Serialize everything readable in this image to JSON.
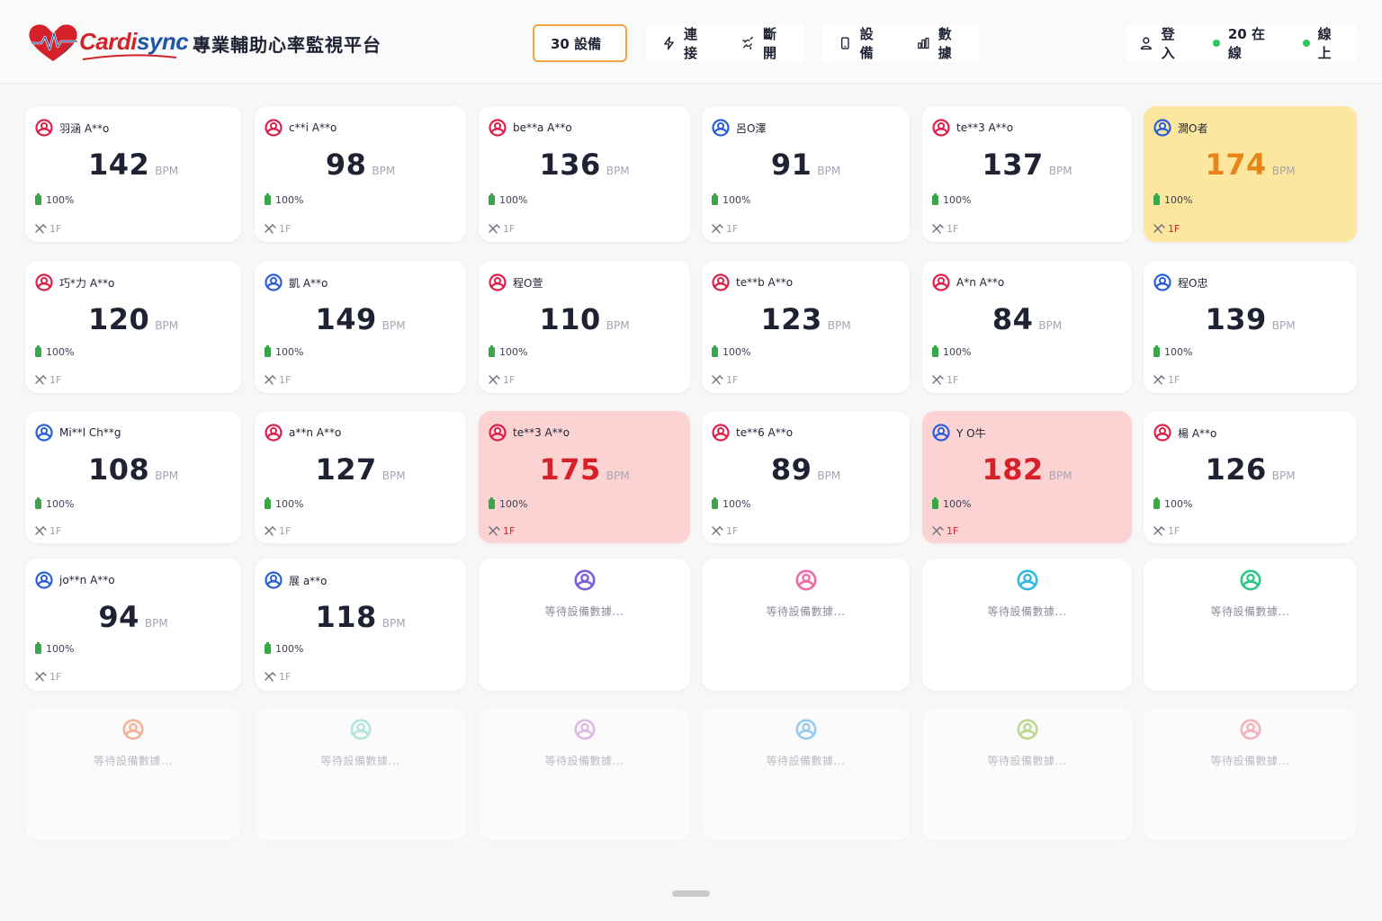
{
  "header": {
    "brand_left": "Cardi",
    "brand_right": "sync",
    "platform_title": "專業輔助心率監視平台",
    "device_count_button": "30 設備",
    "connect_label": "連接",
    "disconnect_label": "斷開",
    "devices_label": "設備",
    "data_label": "數據",
    "login_label": "登入",
    "online_count": "20 在線",
    "online_status": "線上",
    "status_color": "#2fc55a",
    "accent_color": "#f0a44a"
  },
  "unit": "BPM",
  "waiting_text": "等待設備數據...",
  "cards": [
    {
      "name": "羽涵 A**o",
      "bpm": "142",
      "battery": "100%",
      "floor": "1F",
      "gender": "female",
      "state": "normal"
    },
    {
      "name": "c**i A**o",
      "bpm": "98",
      "battery": "100%",
      "floor": "1F",
      "gender": "female",
      "state": "normal"
    },
    {
      "name": "be**a A**o",
      "bpm": "136",
      "battery": "100%",
      "floor": "1F",
      "gender": "female",
      "state": "normal"
    },
    {
      "name": "呂O澤",
      "bpm": "91",
      "battery": "100%",
      "floor": "1F",
      "gender": "male",
      "state": "normal"
    },
    {
      "name": "te**3 A**o",
      "bpm": "137",
      "battery": "100%",
      "floor": "1F",
      "gender": "female",
      "state": "normal"
    },
    {
      "name": "澗O者",
      "bpm": "174",
      "battery": "100%",
      "floor": "1F",
      "gender": "male",
      "state": "warn"
    },
    {
      "name": "巧*力 A**o",
      "bpm": "120",
      "battery": "100%",
      "floor": "1F",
      "gender": "female",
      "state": "normal"
    },
    {
      "name": "凱 A**o",
      "bpm": "149",
      "battery": "100%",
      "floor": "1F",
      "gender": "male",
      "state": "normal"
    },
    {
      "name": "程O萱",
      "bpm": "110",
      "battery": "100%",
      "floor": "1F",
      "gender": "female",
      "state": "normal"
    },
    {
      "name": "te**b A**o",
      "bpm": "123",
      "battery": "100%",
      "floor": "1F",
      "gender": "female",
      "state": "normal"
    },
    {
      "name": "A*n A**o",
      "bpm": "84",
      "battery": "100%",
      "floor": "1F",
      "gender": "female",
      "state": "normal"
    },
    {
      "name": "程O忠",
      "bpm": "139",
      "battery": "100%",
      "floor": "1F",
      "gender": "male",
      "state": "normal"
    },
    {
      "name": "Mi**l Ch**g",
      "bpm": "108",
      "battery": "100%",
      "floor": "1F",
      "gender": "male",
      "state": "normal"
    },
    {
      "name": "a**n A**o",
      "bpm": "127",
      "battery": "100%",
      "floor": "1F",
      "gender": "female",
      "state": "normal"
    },
    {
      "name": "te**3 A**o",
      "bpm": "175",
      "battery": "100%",
      "floor": "1F",
      "gender": "female",
      "state": "alert"
    },
    {
      "name": "te**6 A**o",
      "bpm": "89",
      "battery": "100%",
      "floor": "1F",
      "gender": "female",
      "state": "normal"
    },
    {
      "name": "Y O牛",
      "bpm": "182",
      "battery": "100%",
      "floor": "1F",
      "gender": "male",
      "state": "alert"
    },
    {
      "name": "楊 A**o",
      "bpm": "126",
      "battery": "100%",
      "floor": "1F",
      "gender": "female",
      "state": "normal"
    },
    {
      "name": "jo**n A**o",
      "bpm": "94",
      "battery": "100%",
      "floor": "1F",
      "gender": "male",
      "state": "normal"
    },
    {
      "name": "展 a**o",
      "bpm": "118",
      "battery": "100%",
      "floor": "1F",
      "gender": "male",
      "state": "normal"
    }
  ],
  "waiting": [
    {
      "color": "#7b61d9"
    },
    {
      "color": "#f06aa8"
    },
    {
      "color": "#35b8e0"
    },
    {
      "color": "#2fc58a"
    },
    {
      "color": "#f2784b"
    },
    {
      "color": "#7fd6c8"
    },
    {
      "color": "#c889d6"
    },
    {
      "color": "#4aa8ec"
    },
    {
      "color": "#8fbf3a"
    },
    {
      "color": "#f07a8c"
    }
  ],
  "colors": {
    "female": "#e0204a",
    "male": "#2a5fd9",
    "warn_bg": "#fde69d",
    "alert_bg": "#fcd3d3"
  }
}
